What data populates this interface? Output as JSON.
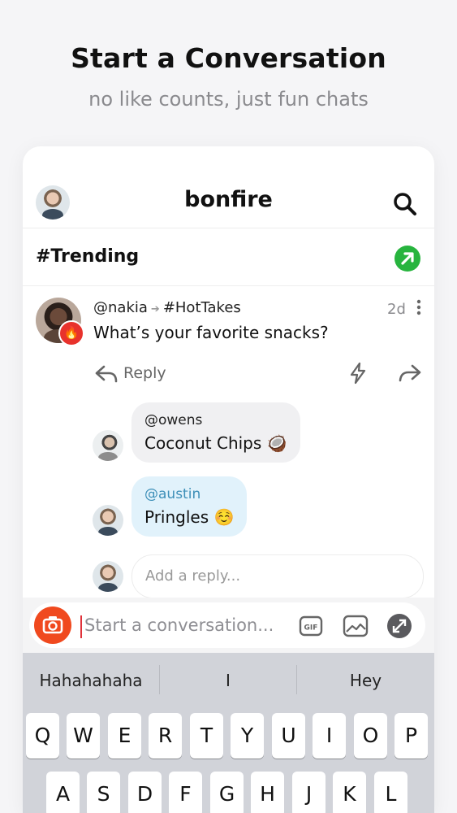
{
  "hero": {
    "title": "Start a Conversation",
    "subtitle": "no like counts, just fun chats"
  },
  "app": {
    "brand": "bonfire",
    "trending_label": "#Trending"
  },
  "post": {
    "author": "@nakia",
    "channel": "#HotTakes",
    "time": "2d",
    "body": "What’s your favorite snacks?",
    "reply_label": "Reply"
  },
  "replies": [
    {
      "author": "@owens",
      "text": "Coconut Chips 🥥"
    },
    {
      "author": "@austin",
      "text": "Pringles ☺️"
    }
  ],
  "reply_input": {
    "placeholder": "Add a reply..."
  },
  "composer": {
    "placeholder": "Start a conversation...",
    "gif_label": "GIF"
  },
  "keyboard": {
    "suggestions": [
      "Hahahahaha",
      "I",
      "Hey"
    ],
    "row1": [
      "Q",
      "W",
      "E",
      "R",
      "T",
      "Y",
      "U",
      "I",
      "O",
      "P"
    ],
    "row2": [
      "A",
      "S",
      "D",
      "F",
      "G",
      "H",
      "J",
      "K",
      "L"
    ]
  },
  "colors": {
    "accent_green": "#27b43e",
    "camera_orange": "#f0491e",
    "mention_blue": "#3d8fb8"
  }
}
